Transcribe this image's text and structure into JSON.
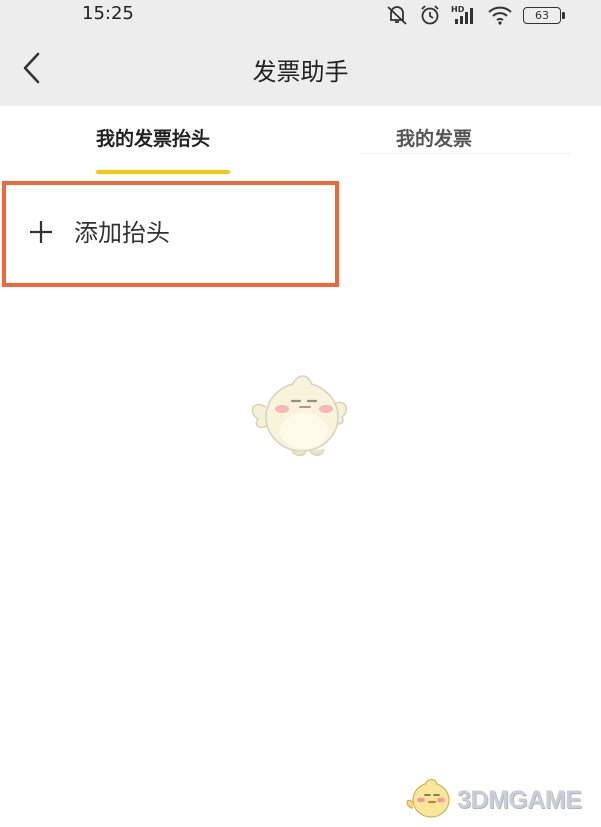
{
  "status_bar": {
    "time": "15:25",
    "battery": "63",
    "icons": [
      "mute-icon",
      "alarm-icon",
      "hd-signal-icon",
      "wifi-icon",
      "battery-icon"
    ]
  },
  "nav": {
    "title": "发票助手",
    "back_icon": "chevron-left-icon"
  },
  "tabs": [
    {
      "label": "我的发票抬头",
      "active": true
    },
    {
      "label": "我的发票",
      "active": false
    }
  ],
  "add_header": {
    "icon": "plus-icon",
    "label": "添加抬头"
  },
  "empty_state": {
    "icon": "mascot-chick-illustration"
  },
  "watermark": {
    "text": "3DMGAME"
  },
  "colors": {
    "accent_tab": "#f2c811",
    "highlight_border": "#f0683a",
    "header_bg": "#ededed"
  }
}
